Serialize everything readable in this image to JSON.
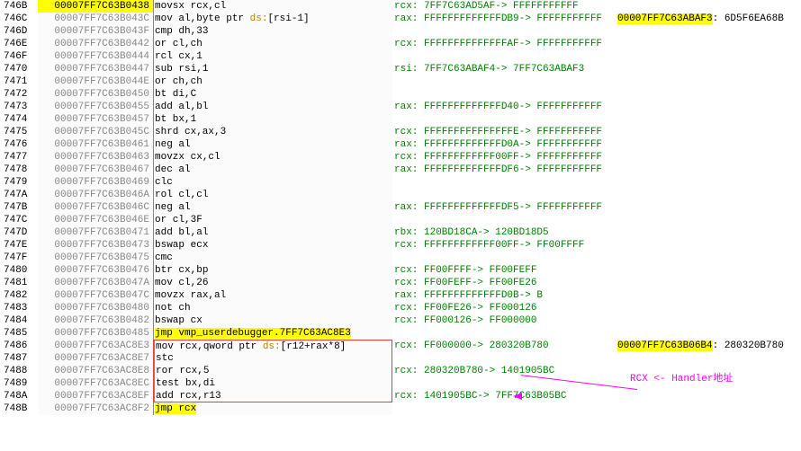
{
  "annotation": "RCX <- Handler地址",
  "rows": [
    {
      "idx": "746B",
      "addr": "00007FF7C63B0438",
      "sel": true,
      "asm": [
        "movsx",
        " rcx,cl"
      ],
      "info": "rcx: 7FF7C63AD5AF-> FFFFFFFFFFF",
      "c5a": "",
      "c5b": ""
    },
    {
      "idx": "746C",
      "addr": "00007FF7C63B043C",
      "asm": [
        "mov",
        " al,byte ptr ",
        "ds:",
        "[rsi-1]"
      ],
      "ds": 2,
      "info": "rax: FFFFFFFFFFFFFDB9-> FFFFFFFFFFF",
      "c5a": "00007FF7C63ABAF3",
      "c5b": ": 6D5F6EA68B",
      "hl": true
    },
    {
      "idx": "746D",
      "addr": "00007FF7C63B043F",
      "asm": [
        "cmp",
        " dh,33"
      ],
      "info": "",
      "c5a": "",
      "c5b": ""
    },
    {
      "idx": "746E",
      "addr": "00007FF7C63B0442",
      "asm": [
        "or",
        " cl,ch"
      ],
      "info": "rcx: FFFFFFFFFFFFFFAF-> FFFFFFFFFFF",
      "c5a": "",
      "c5b": ""
    },
    {
      "idx": "746F",
      "addr": "00007FF7C63B0444",
      "asm": [
        "rcl",
        " cx,1"
      ],
      "info": "",
      "c5a": "",
      "c5b": ""
    },
    {
      "idx": "7470",
      "addr": "00007FF7C63B0447",
      "asm": [
        "sub",
        " rsi,1"
      ],
      "info": "rsi: 7FF7C63ABAF4-> 7FF7C63ABAF3",
      "c5a": "",
      "c5b": ""
    },
    {
      "idx": "7471",
      "addr": "00007FF7C63B044E",
      "asm": [
        "or",
        " ch,ch"
      ],
      "info": "",
      "c5a": "",
      "c5b": ""
    },
    {
      "idx": "7472",
      "addr": "00007FF7C63B0450",
      "asm": [
        "bt",
        " di,C"
      ],
      "info": "",
      "c5a": "",
      "c5b": ""
    },
    {
      "idx": "7473",
      "addr": "00007FF7C63B0455",
      "asm": [
        "add",
        " al,bl"
      ],
      "info": "rax: FFFFFFFFFFFFFD40-> FFFFFFFFFFF",
      "c5a": "",
      "c5b": ""
    },
    {
      "idx": "7474",
      "addr": "00007FF7C63B0457",
      "asm": [
        "bt",
        " bx,1"
      ],
      "info": "",
      "c5a": "",
      "c5b": ""
    },
    {
      "idx": "7475",
      "addr": "00007FF7C63B045C",
      "asm": [
        "shrd",
        " cx,ax,3"
      ],
      "info": "rcx: FFFFFFFFFFFFFFFE-> FFFFFFFFFFF",
      "c5a": "",
      "c5b": ""
    },
    {
      "idx": "7476",
      "addr": "00007FF7C63B0461",
      "asm": [
        "neg",
        " al"
      ],
      "info": "rax: FFFFFFFFFFFFFD0A-> FFFFFFFFFFF",
      "c5a": "",
      "c5b": ""
    },
    {
      "idx": "7477",
      "addr": "00007FF7C63B0463",
      "asm": [
        "movzx",
        " cx,cl"
      ],
      "info": "rcx: FFFFFFFFFFFF00FF-> FFFFFFFFFFF",
      "c5a": "",
      "c5b": ""
    },
    {
      "idx": "7478",
      "addr": "00007FF7C63B0467",
      "asm": [
        "dec",
        " al"
      ],
      "info": "rax: FFFFFFFFFFFFFDF6-> FFFFFFFFFFF",
      "c5a": "",
      "c5b": ""
    },
    {
      "idx": "7479",
      "addr": "00007FF7C63B0469",
      "asm": [
        "clc",
        ""
      ],
      "info": "",
      "c5a": "",
      "c5b": ""
    },
    {
      "idx": "747A",
      "addr": "00007FF7C63B046A",
      "asm": [
        "rol",
        " cl,cl"
      ],
      "info": "",
      "c5a": "",
      "c5b": ""
    },
    {
      "idx": "747B",
      "addr": "00007FF7C63B046C",
      "asm": [
        "neg",
        " al"
      ],
      "info": "rax: FFFFFFFFFFFFFDF5-> FFFFFFFFFFF",
      "c5a": "",
      "c5b": ""
    },
    {
      "idx": "747C",
      "addr": "00007FF7C63B046E",
      "asm": [
        "or",
        " cl,3F"
      ],
      "info": "",
      "c5a": "",
      "c5b": ""
    },
    {
      "idx": "747D",
      "addr": "00007FF7C63B0471",
      "asm": [
        "add",
        " bl,al"
      ],
      "info": "rbx: 120BD18CA-> 120BD18D5",
      "c5a": "",
      "c5b": ""
    },
    {
      "idx": "747E",
      "addr": "00007FF7C63B0473",
      "asm": [
        "bswap",
        " ecx"
      ],
      "info": "rcx: FFFFFFFFFFFF00FF-> FF00FFFF",
      "c5a": "",
      "c5b": ""
    },
    {
      "idx": "747F",
      "addr": "00007FF7C63B0475",
      "asm": [
        "cmc",
        ""
      ],
      "info": "",
      "c5a": "",
      "c5b": ""
    },
    {
      "idx": "7480",
      "addr": "00007FF7C63B0476",
      "asm": [
        "btr",
        " cx,bp"
      ],
      "info": "rcx: FF00FFFF-> FF00FEFF",
      "c5a": "",
      "c5b": ""
    },
    {
      "idx": "7481",
      "addr": "00007FF7C63B047A",
      "asm": [
        "mov",
        " cl,26"
      ],
      "info": "rcx: FF00FEFF-> FF00FE26",
      "c5a": "",
      "c5b": ""
    },
    {
      "idx": "7482",
      "addr": "00007FF7C63B047C",
      "asm": [
        "movzx",
        " rax,al"
      ],
      "info": "rax: FFFFFFFFFFFFFD0B-> B",
      "c5a": "",
      "c5b": ""
    },
    {
      "idx": "7483",
      "addr": "00007FF7C63B0480",
      "asm": [
        "not",
        " ch"
      ],
      "info": "rcx: FF00FE26-> FF000126",
      "c5a": "",
      "c5b": ""
    },
    {
      "idx": "7484",
      "addr": "00007FF7C63B0482",
      "asm": [
        "bswap",
        " cx"
      ],
      "info": "rcx: FF000126-> FF000000",
      "c5a": "",
      "c5b": ""
    },
    {
      "idx": "7485",
      "addr": "00007FF7C63B0485",
      "asm_hl": "jmp vmp_userdebugger.7FF7C63AC8E3",
      "info": "",
      "c5a": "",
      "c5b": ""
    },
    {
      "idx": "7486",
      "addr": "00007FF7C63AC8E3",
      "asm": [
        "mov",
        " rcx,qword ptr ",
        "ds:",
        "[r12+rax*8]"
      ],
      "ds": 2,
      "info": "rcx: FF000000-> 280320B780",
      "c5a": "00007FF7C63B06B4",
      "c5b": ": 280320B780",
      "hl": true,
      "box": "top"
    },
    {
      "idx": "7487",
      "addr": "00007FF7C63AC8E7",
      "asm": [
        "stc",
        ""
      ],
      "info": "",
      "c5a": "",
      "c5b": "",
      "box": "mid"
    },
    {
      "idx": "7488",
      "addr": "00007FF7C63AC8E8",
      "asm": [
        "ror",
        " rcx,5"
      ],
      "info": "rcx: 280320B780-> 1401905BC",
      "c5a": "",
      "c5b": "",
      "box": "mid"
    },
    {
      "idx": "7489",
      "addr": "00007FF7C63AC8EC",
      "asm": [
        "test",
        " bx,di"
      ],
      "info": "",
      "c5a": "",
      "c5b": "",
      "box": "mid"
    },
    {
      "idx": "748A",
      "addr": "00007FF7C63AC8EF",
      "asm": [
        "add",
        " rcx,r13"
      ],
      "info": "rcx: 1401905BC-> 7FF7C63B05BC",
      "c5a": "",
      "c5b": "",
      "box": "bot"
    },
    {
      "idx": "748B",
      "addr": "00007FF7C63AC8F2",
      "asm_hl": "jmp rcx",
      "info": "",
      "c5a": "",
      "c5b": ""
    }
  ]
}
